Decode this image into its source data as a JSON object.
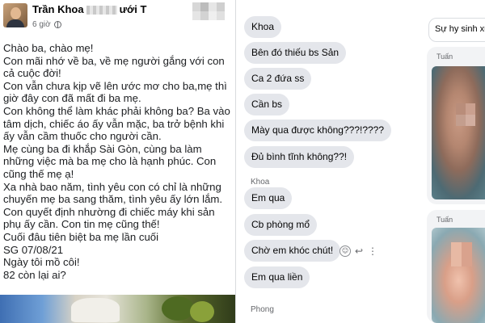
{
  "post": {
    "author": "Trần Khoa",
    "author_suffix": "ưới T",
    "time": "6 giờ",
    "paragraphs": [
      "Chào ba, chào mẹ!",
      "Con mãi nhớ về ba, về mẹ người gắng với con cả cuộc đời!",
      "Con vẫn chưa kịp vẽ lên ước mơ cho ba,mẹ thì giờ đây con đã mất đi ba mẹ.",
      "Con không thể làm khác phải không ba? Ba vào tâm dịch, chiếc áo ấy vẫn mặc, ba trở bệnh khi ấy vẫn cầm thuốc cho người cần.",
      "Mẹ cùng ba đi khắp Sài Gòn, cùng ba làm những việc mà ba mẹ cho là hạnh phúc. Con cũng thế mẹ ạ!",
      "Xa nhà bao năm, tình yêu con có chỉ là những chuyến mẹ ba sang thăm, tình yêu ấy lớn lắm. Con quyết định nhường đi chiếc máy khi sản phụ ấy cần. Con tin mẹ cũng thế!",
      "Cuối đâu tiên biệt ba mẹ lần cuối",
      "SG 07/08/21",
      "Ngày tôi mồ côi!",
      "82 còn lại ai?"
    ]
  },
  "chat": {
    "messages_group1": [
      "Khoa",
      "Bên đó thiếu bs Sản",
      "Ca 2 đứa ss",
      "Cần bs",
      "Mày qua được không???!????",
      "Đủ bình tĩnh không??!"
    ],
    "sender_khoa": "Khoa",
    "messages_group2": [
      "Em qua",
      "Cb phòng mổ",
      "Chờ em khóc chút!",
      "Em qua liền"
    ],
    "sender_phong": "Phong",
    "icons": [
      "smile-icon",
      "reply-icon",
      "more-icon"
    ]
  },
  "stories": {
    "top_title": "Sự hy sinh xu",
    "card_labels": [
      "Tuấn",
      "Tuấn"
    ]
  }
}
